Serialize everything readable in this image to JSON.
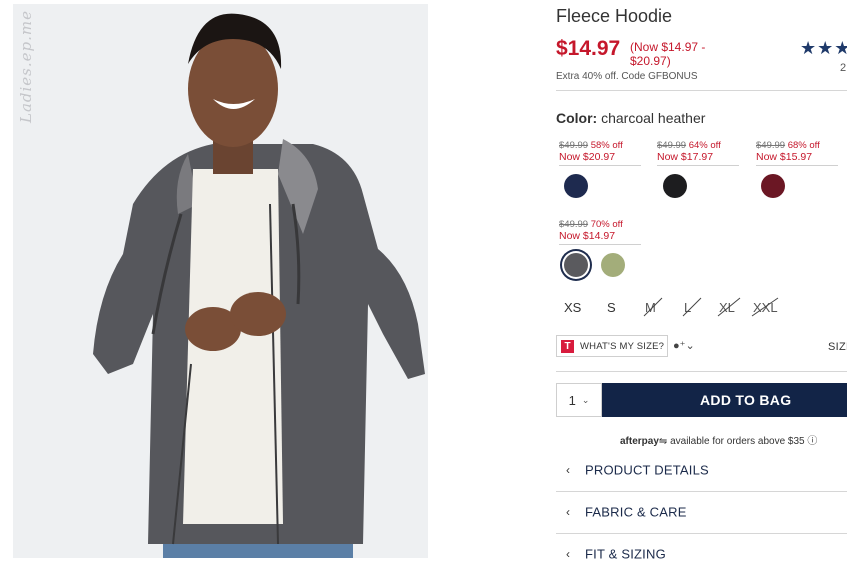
{
  "watermark": "Ladies.ep.me",
  "product": {
    "title": "Fleece Hoodie",
    "price": "$14.97",
    "price_range": "(Now $14.97 - $20.97)",
    "promo": "Extra 40% off. Code GFBONUS",
    "rating_stars": "★★★",
    "review_count": "2"
  },
  "color": {
    "label": "Color:",
    "value": "charcoal heather"
  },
  "swatch_groups": [
    {
      "was": "$49.99",
      "off": "58% off",
      "now": "Now $20.97",
      "swatches": [
        {
          "name": "navy",
          "color": "#1e2a4f"
        }
      ]
    },
    {
      "was": "$49.99",
      "off": "64% off",
      "now": "Now $17.97",
      "swatches": [
        {
          "name": "black",
          "color": "#1d1d1f"
        }
      ]
    },
    {
      "was": "$49.99",
      "off": "68% off",
      "now": "Now $15.97",
      "swatches": [
        {
          "name": "burgundy",
          "color": "#6b1724"
        }
      ]
    },
    {
      "was": "$49.99",
      "off": "70% off",
      "now": "Now $14.97",
      "swatches": [
        {
          "name": "charcoal heather",
          "color": "#5a5a5e",
          "selected": true
        },
        {
          "name": "olive",
          "color": "#a3ad7a"
        }
      ]
    }
  ],
  "sizes": [
    {
      "label": "XS",
      "available": true
    },
    {
      "label": "S",
      "available": true
    },
    {
      "label": "M",
      "available": false
    },
    {
      "label": "L",
      "available": false
    },
    {
      "label": "XL",
      "available": false
    },
    {
      "label": "XXL",
      "available": false
    }
  ],
  "fit_tool": {
    "badge": "T",
    "label": "WHAT'S MY SIZE?",
    "profile_icon": "person-plus-icon"
  },
  "size_chart_label": "SIZE",
  "quantity": "1",
  "add_to_bag": "ADD TO BAG",
  "afterpay": {
    "brand": "afterpay",
    "text": "available for orders above $35"
  },
  "accordions": [
    {
      "label": "PRODUCT DETAILS"
    },
    {
      "label": "FABRIC & CARE"
    },
    {
      "label": "FIT & SIZING"
    }
  ],
  "colors": {
    "sale_red": "#c5172b",
    "navy_button": "#122447",
    "star_blue": "#1f3a6a"
  }
}
